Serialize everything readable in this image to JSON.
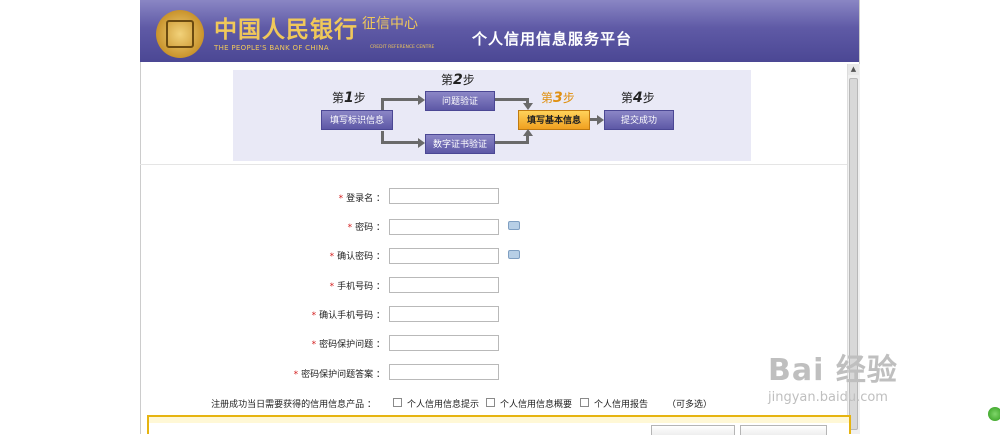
{
  "header": {
    "bank_name_cn": "中国人民银行",
    "credit_center_cn": "征信中心",
    "bank_name_en": "THE PEOPLE'S BANK OF CHINA",
    "credit_center_en": "CREDIT REFERENCE CENTRE",
    "platform_title": "个人信用信息服务平台",
    "logo_icon": "pboc-emblem-icon"
  },
  "steps": [
    {
      "prefix": "第",
      "num": "1",
      "suffix": "步",
      "label": "填写标识信息"
    },
    {
      "prefix": "第",
      "num": "2",
      "suffix": "步",
      "label": "问题验证"
    },
    {
      "alt_label": "数字证书验证"
    },
    {
      "prefix": "第",
      "num": "3",
      "suffix": "步",
      "label": "填写基本信息",
      "active": true
    },
    {
      "prefix": "第",
      "num": "4",
      "suffix": "步",
      "label": "提交成功"
    }
  ],
  "form": {
    "required_mark": "*",
    "fields": [
      {
        "label": "登录名 ：",
        "value": ""
      },
      {
        "label": "密码 ：",
        "value": ""
      },
      {
        "label": "确认密码 ：",
        "value": ""
      },
      {
        "label": "手机号码 ：",
        "value": ""
      },
      {
        "label": "确认手机号码 ：",
        "value": ""
      },
      {
        "label": "密码保护问题 ：",
        "value": ""
      },
      {
        "label": "密码保护问题答案 ：",
        "value": ""
      }
    ],
    "products_label": "注册成功当日需要获得的信用信息产品 ：",
    "products": [
      {
        "label": "个人信用信息提示",
        "checked": false
      },
      {
        "label": "个人信用信息概要",
        "checked": false
      },
      {
        "label": "个人信用报告",
        "checked": false
      }
    ],
    "multi_hint": "（可多选）"
  },
  "watermark": {
    "main": "Bai 经验",
    "sub": "jingyan.baidu.com"
  },
  "colors": {
    "banner": "#5f5aa6",
    "accent_gold": "#f0c85a",
    "active_step": "#f0a020",
    "required": "#d42020"
  }
}
